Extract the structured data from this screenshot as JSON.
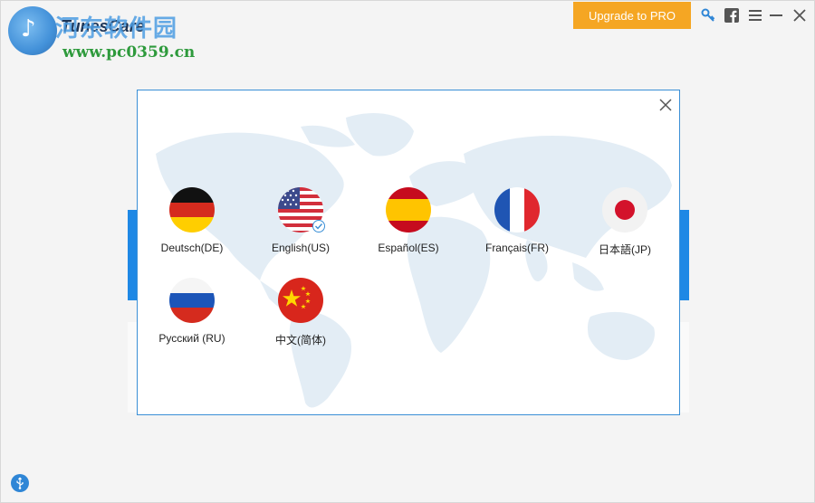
{
  "app": {
    "name": "TunesCare",
    "watermark_cn": "河东软件园",
    "watermark_url": "www.pc0359.cn"
  },
  "toolbar": {
    "upgrade_label": "Upgrade to PRO",
    "icons": [
      "key-icon",
      "facebook-icon",
      "menu-icon",
      "minimize-icon",
      "close-icon"
    ]
  },
  "dialog": {
    "languages": [
      {
        "code": "DE",
        "label": "Deutsch(DE)",
        "selected": false
      },
      {
        "code": "US",
        "label": "English(US)",
        "selected": true
      },
      {
        "code": "ES",
        "label": "Español(ES)",
        "selected": false
      },
      {
        "code": "FR",
        "label": "Français(FR)",
        "selected": false
      },
      {
        "code": "JP",
        "label": "日本語(JP)",
        "selected": false
      },
      {
        "code": "RU",
        "label": "Русский (RU)",
        "selected": false
      },
      {
        "code": "CN",
        "label": "中文(简体)",
        "selected": false
      }
    ]
  },
  "colors": {
    "accent": "#1e88e5",
    "upgrade": "#f5a623",
    "dialog_border": "#3a8fd6"
  }
}
